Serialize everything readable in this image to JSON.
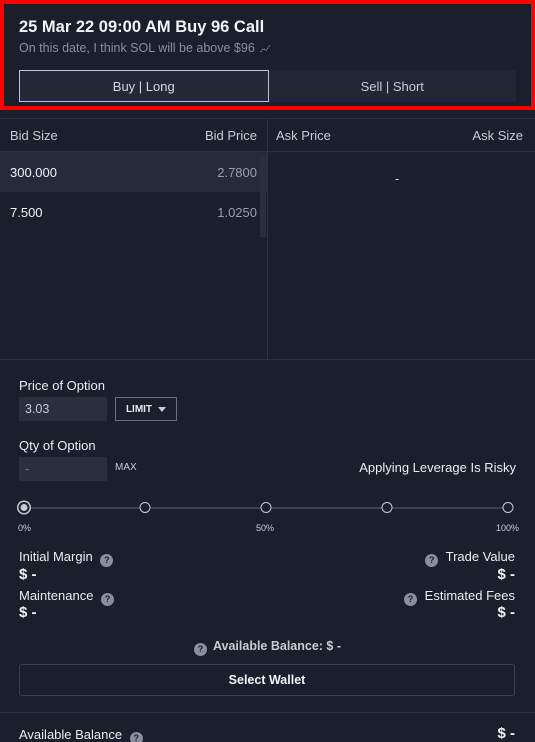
{
  "header": {
    "title": "25 Mar 22 09:00 AM Buy 96 Call",
    "subtitle": "On this date, I think SOL will be above $96",
    "subtitle_icon": "chart-icon",
    "tabs": [
      {
        "label": "Buy | Long",
        "active": true
      },
      {
        "label": "Sell | Short",
        "active": false
      }
    ],
    "highlight_border_color": "#ff0000"
  },
  "orderbook": {
    "bid_size_header": "Bid Size",
    "bid_price_header": "Bid Price",
    "ask_price_header": "Ask Price",
    "ask_size_header": "Ask Size",
    "bids": [
      {
        "size": "300.000",
        "price": "2.7800"
      },
      {
        "size": "7.500",
        "price": "1.0250"
      }
    ],
    "ask_placeholder": "-"
  },
  "order": {
    "price_label": "Price of Option",
    "price_value": "3.03",
    "order_type": "LIMIT",
    "qty_label": "Qty of Option",
    "qty_placeholder": "-",
    "max_label": "MAX",
    "leverage_text": "Applying Leverage Is Risky",
    "slider": {
      "value_percent": 0,
      "stops": [
        0,
        25,
        50,
        75,
        100
      ],
      "labels": [
        "0%",
        "50%",
        "100%"
      ]
    },
    "initial_margin_label": "Initial Margin",
    "initial_margin_value": "$ -",
    "trade_value_label": "Trade Value",
    "trade_value_value": "$ -",
    "maintenance_label": "Maintenance",
    "maintenance_value": "$ -",
    "estimated_fees_label": "Estimated Fees",
    "estimated_fees_value": "$ -",
    "available_balance_text": "Available Balance: $ -",
    "select_wallet_label": "Select Wallet"
  },
  "footer": {
    "available_balance_label": "Available Balance",
    "available_balance_value": "$ -"
  }
}
